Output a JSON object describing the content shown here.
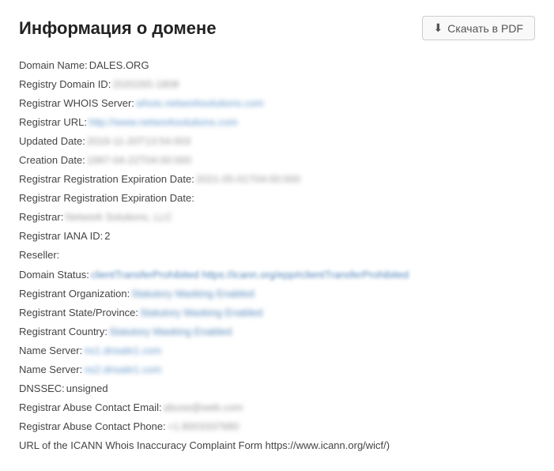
{
  "header": {
    "title": "Информация о домене",
    "pdf_button_label": "Скачать в PDF"
  },
  "fields": [
    {
      "label": "Domain Name:",
      "value": "DALES.ORG",
      "style": "clear",
      "bold": true
    },
    {
      "label": "Registry Domain ID:",
      "value": "2020265-1808",
      "style": "blurred"
    },
    {
      "label": "Registrar WHOIS Server:",
      "value": "whois.networksolutions.com",
      "style": "link-style"
    },
    {
      "label": "Registrar URL:",
      "value": "http://www.networksolutions.com",
      "style": "link-style"
    },
    {
      "label": "Updated Date:",
      "value": "2019-11-20T13:54:003",
      "style": "blurred"
    },
    {
      "label": "Creation Date:",
      "value": "1997-04-22T04:00:000",
      "style": "blurred"
    },
    {
      "label": "Registrar Registration Expiration Date:",
      "value": "2021-05-01T04:00:000",
      "style": "blurred"
    },
    {
      "label": "Registrar Registration Expiration Date:",
      "value": "",
      "style": "clear"
    },
    {
      "label": "Registrar:",
      "value": "Network Solutions, LLC",
      "style": "blurred"
    },
    {
      "label": "Registrar IANA ID:",
      "value": "2",
      "style": "clear"
    },
    {
      "label": "Reseller:",
      "value": "",
      "style": "clear"
    },
    {
      "label": "Domain Status:",
      "value": "clientTransferProhibited https://icann.org/epp#clientTransferProhibited",
      "style": "status-blue"
    },
    {
      "label": "Registrant Organization:",
      "value": "Statutory Masking Enabled",
      "style": "redacted-name"
    },
    {
      "label": "Registrant State/Province:",
      "value": "Statutory Masking Enabled",
      "style": "redacted-name"
    },
    {
      "label": "Registrant Country:",
      "value": "Statutory Masking Enabled",
      "style": "redacted-name"
    },
    {
      "label": "Name Server:",
      "value": "ns1.dnsale1.com",
      "style": "link-style"
    },
    {
      "label": "Name Server:",
      "value": "ns2.dnsale1.com",
      "style": "link-style"
    },
    {
      "label": "DNSSEC:",
      "value": "unsigned",
      "style": "clear"
    },
    {
      "label": "Registrar Abuse Contact Email:",
      "value": "abuse@web.com",
      "style": "blurred"
    },
    {
      "label": "Registrar Abuse Contact Phone:",
      "value": "+1.8003337680",
      "style": "blurred"
    },
    {
      "label": "URL of the ICANN Whois Inaccuracy Complaint Form https://www.icann.org/wicf/)",
      "value": "",
      "style": "clear"
    }
  ]
}
